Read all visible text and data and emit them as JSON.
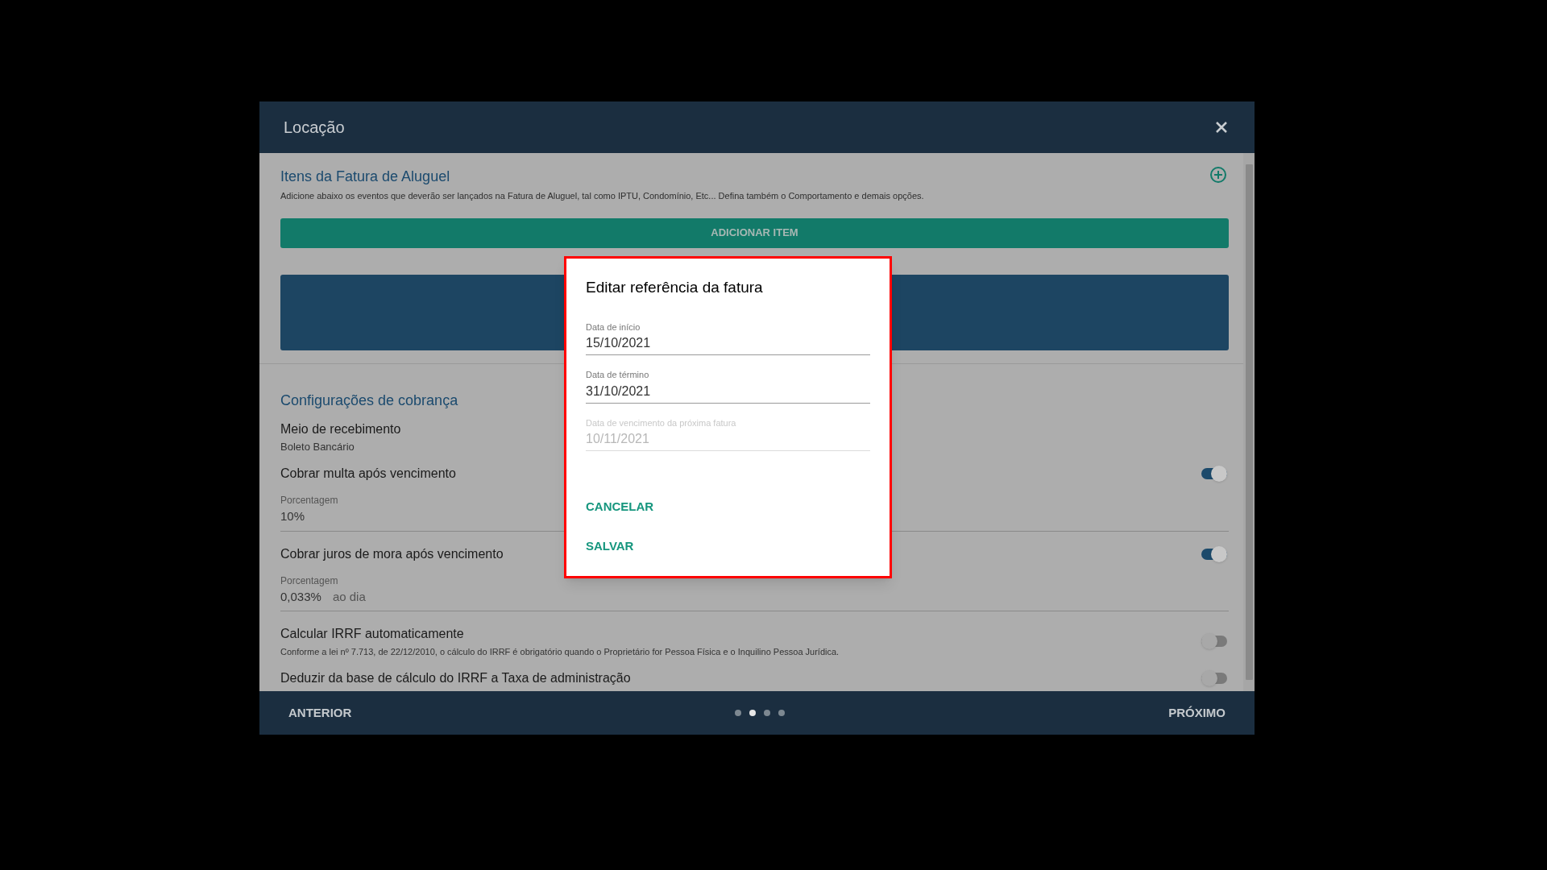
{
  "window": {
    "title": "Locação"
  },
  "items_section": {
    "title": "Itens da Fatura de Aluguel",
    "description": "Adicione abaixo os eventos que deverão ser lançados na Fatura de Aluguel, tal como IPTU, Condomínio, Etc... Defina também o Comportamento e demais opções.",
    "add_button": "ADICIONAR ITEM"
  },
  "billing": {
    "title": "Configurações de cobrança",
    "rows": [
      {
        "kind": "info",
        "label": "Meio de recebimento",
        "value": "Boleto Bancário"
      },
      {
        "kind": "toggle",
        "label": "Cobrar multa após vencimento",
        "on": true
      },
      {
        "kind": "field",
        "label": "Porcentagem",
        "value": "10%"
      },
      {
        "kind": "toggle",
        "label": "Cobrar juros de mora após vencimento",
        "on": true
      },
      {
        "kind": "field",
        "label": "Porcentagem",
        "value": "0,033%",
        "suffix": "ao dia"
      },
      {
        "kind": "toggle",
        "label": "Calcular IRRF automaticamente",
        "on": false,
        "description": "Conforme a lei nº 7.713, de 22/12/2010, o cálculo do IRRF é obrigatório quando o Proprietário for Pessoa Física e o Inquilino Pessoa Jurídica."
      },
      {
        "kind": "toggle",
        "label": "Deduzir da base de cálculo do IRRF a Taxa de administração",
        "on": false
      }
    ]
  },
  "dialog": {
    "title": "Editar referência da fatura",
    "fields": [
      {
        "label": "Data de início",
        "value": "15/10/2021",
        "disabled": false
      },
      {
        "label": "Data de término",
        "value": "31/10/2021",
        "disabled": false
      },
      {
        "label": "Data de vencimento da próxima fatura",
        "value": "10/11/2021",
        "disabled": true
      }
    ],
    "buttons": [
      "CANCELAR",
      "SALVAR"
    ]
  },
  "footer": {
    "previous": "ANTERIOR",
    "next": "PRÓXIMO",
    "pages": [
      {
        "selected": false
      },
      {
        "selected": true
      },
      {
        "selected": false
      },
      {
        "selected": false
      }
    ]
  }
}
